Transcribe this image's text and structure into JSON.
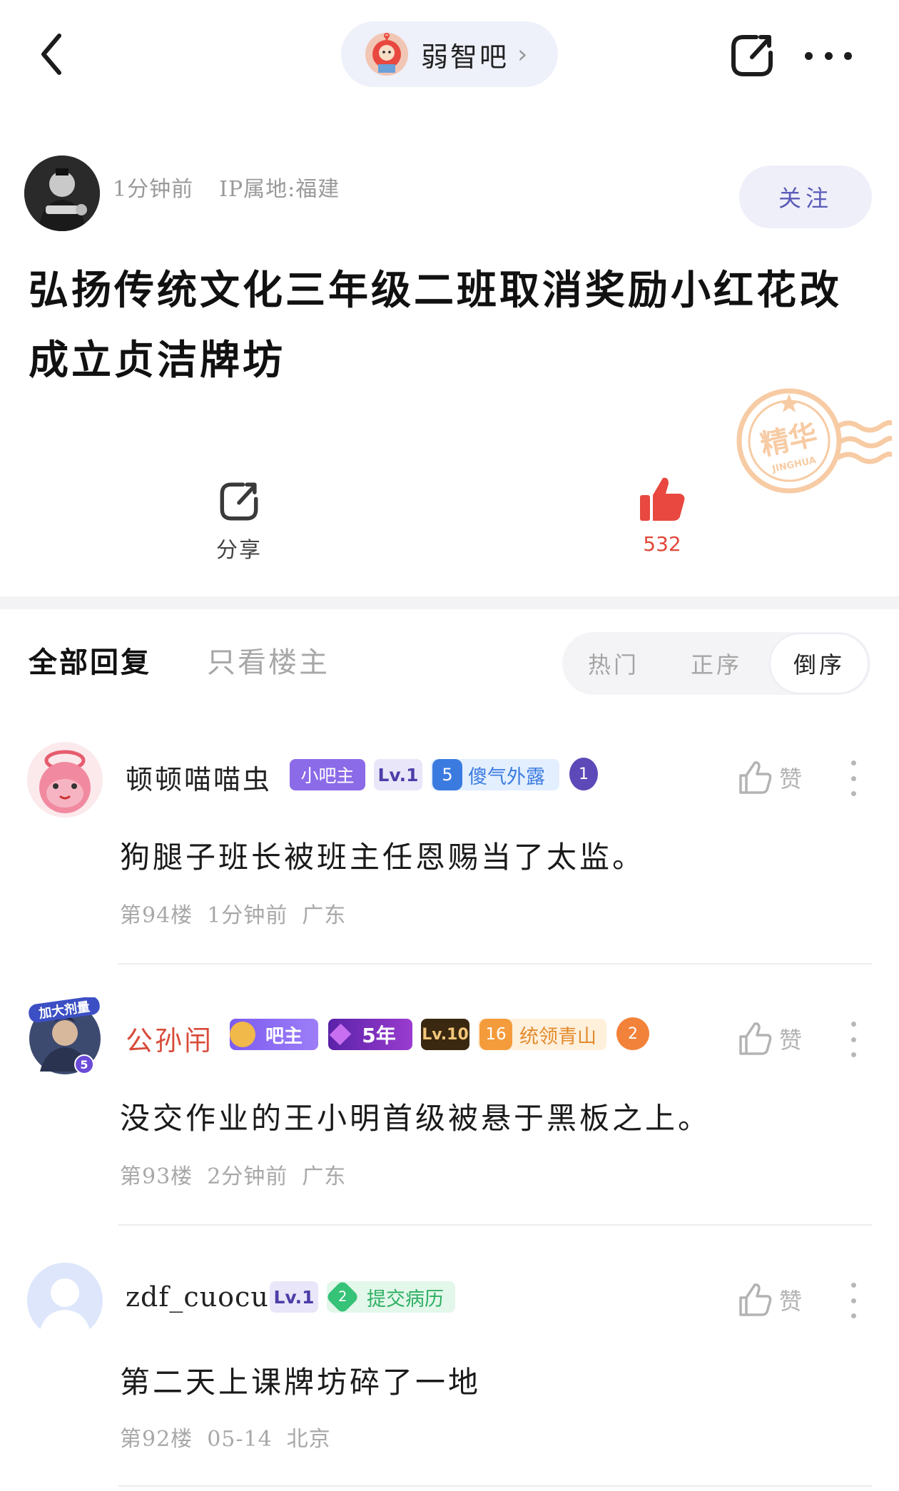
{
  "nav": {
    "forum_name": "弱智吧",
    "forum_arrow": "›"
  },
  "post": {
    "time": "1分钟前",
    "ip_location": "IP属地:福建",
    "follow_label": "关注",
    "title": "弘扬传统文化三年级二班取消奖励小红花改成立贞洁牌坊",
    "stamp_text": "精华",
    "stamp_subtext": "JINGHUA"
  },
  "actions": {
    "share_label": "分享",
    "like_count": "532"
  },
  "tabs": {
    "all_replies": "全部回复",
    "op_only": "只看楼主",
    "sort": [
      "热门",
      "正序",
      "倒序"
    ],
    "sort_selected": "倒序"
  },
  "comments": [
    {
      "username": "顿顿喵喵虫",
      "badges": {
        "role": "小吧主",
        "level": "Lv.1",
        "title_level": "5",
        "title": "傻气外露",
        "rank": "1"
      },
      "body": "狗腿子班长被班主任恩赐当了太监。",
      "floor": "第94楼",
      "time": "1分钟前",
      "location": "广东",
      "like_label": "赞"
    },
    {
      "username": "公孙闬",
      "avatar_tag": "加大剂量",
      "avatar_level": "5",
      "badges": {
        "role": "吧主",
        "years": "5年",
        "level": "Lv.10",
        "title_level": "16",
        "title": "统领青山",
        "rank": "2"
      },
      "body": "没交作业的王小明首级被悬于黑板之上。",
      "floor": "第93楼",
      "time": "2分钟前",
      "location": "广东",
      "like_label": "赞"
    },
    {
      "username": "zdf_cuocuo",
      "badges": {
        "level": "Lv.1",
        "title_level": "2",
        "title": "提交病历"
      },
      "body": "第二天上课牌坊碎了一地",
      "floor": "第92楼",
      "time": "05-14",
      "location": "北京",
      "like_label": "赞"
    }
  ],
  "colors": {
    "accent": "#5a5bb8",
    "like_red": "#e0473a",
    "stamp": "#f2a25a",
    "username_red": "#d84b3a"
  }
}
